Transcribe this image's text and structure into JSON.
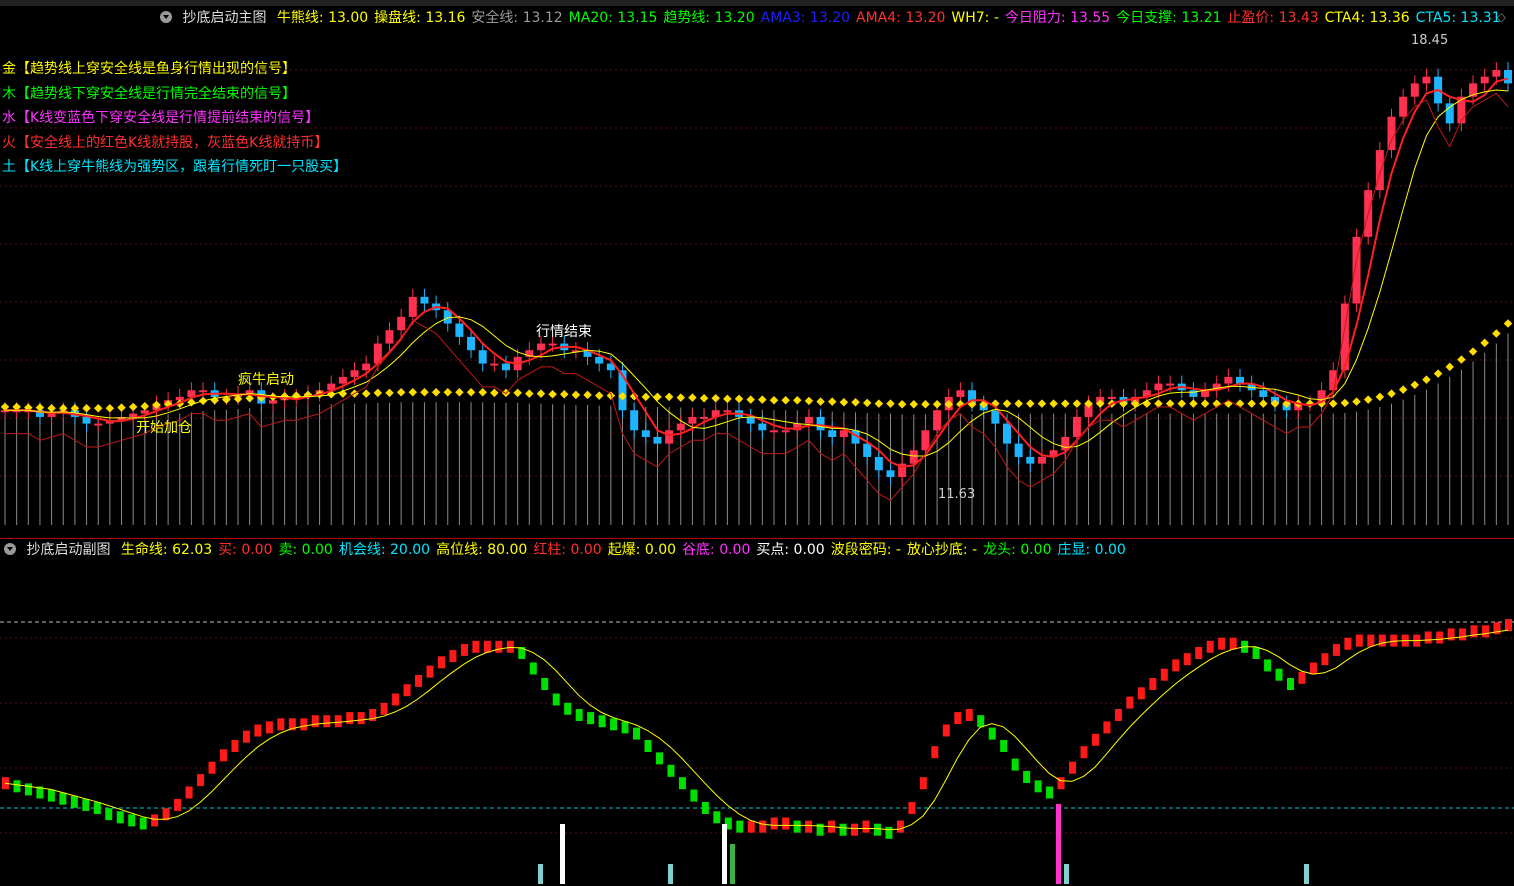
{
  "main": {
    "title": "抄底启动主图",
    "indicators": [
      {
        "label": "牛熊线:",
        "value": "13.00",
        "color": "#ffff00"
      },
      {
        "label": "操盘线:",
        "value": "13.16",
        "color": "#ffff00"
      },
      {
        "label": "安全线:",
        "value": "13.12",
        "color": "#9a9a9a"
      },
      {
        "label": "MA20:",
        "value": "13.15",
        "color": "#00ff00"
      },
      {
        "label": "趋势线:",
        "value": "13.20",
        "color": "#00ff00"
      },
      {
        "label": "AMA3:",
        "value": "13.20",
        "color": "#2020ff"
      },
      {
        "label": "AMA4:",
        "value": "13.20",
        "color": "#ff3030"
      },
      {
        "label": "WH7:",
        "value": "-",
        "color": "#ffff00"
      },
      {
        "label": "今日阻力:",
        "value": "13.55",
        "color": "#ff33ff"
      },
      {
        "label": "今日支撑:",
        "value": "13.21",
        "color": "#00ff00"
      },
      {
        "label": "止盈价:",
        "value": "13.43",
        "color": "#ff3030"
      },
      {
        "label": "CTA4:",
        "value": "13.36",
        "color": "#ffff00"
      },
      {
        "label": "CTA5:",
        "value": "13.31",
        "color": "#00e5ff"
      }
    ],
    "legend": [
      {
        "text": "金【趋势线上穿安全线是鱼身行情出现的信号】",
        "color": "#ffff00"
      },
      {
        "text": "木【趋势线下穿安全线是行情完全结束的信号】",
        "color": "#00ff00"
      },
      {
        "text": "水【K线变蓝色下穿安全线是行情提前结束的信号】",
        "color": "#ff33ff"
      },
      {
        "text": "火【安全线上的红色K线就持股，灰蓝色K线就持币】",
        "color": "#ff3030"
      },
      {
        "text": "土【K线上穿牛熊线为强势区，跟着行情死盯一只股买】",
        "color": "#00e5ff"
      }
    ],
    "annotations": [
      {
        "text": "开始加仓",
        "color": "#ffff00"
      },
      {
        "text": "疯牛启动",
        "color": "#ffff00"
      },
      {
        "text": "行情结束",
        "color": "#ffffff"
      },
      {
        "text": "18.45",
        "color": "#cccccc"
      },
      {
        "text": "11.63",
        "color": "#cccccc"
      }
    ]
  },
  "sub": {
    "title": "抄底启动副图",
    "indicators": [
      {
        "label": "生命线:",
        "value": "62.03",
        "color": "#ffff00"
      },
      {
        "label": "买:",
        "value": "0.00",
        "color": "#ff3030"
      },
      {
        "label": "卖:",
        "value": "0.00",
        "color": "#00ff00"
      },
      {
        "label": "机会线:",
        "value": "20.00",
        "color": "#00e5ff"
      },
      {
        "label": "高位线:",
        "value": "80.00",
        "color": "#ffff00"
      },
      {
        "label": "红柱:",
        "value": "0.00",
        "color": "#ff3030"
      },
      {
        "label": "起爆:",
        "value": "0.00",
        "color": "#ffff00"
      },
      {
        "label": "谷底:",
        "value": "0.00",
        "color": "#ff33ff"
      },
      {
        "label": "买点:",
        "value": "0.00",
        "color": "#ffffff"
      },
      {
        "label": "波段密码:",
        "value": "-",
        "color": "#ffff00"
      },
      {
        "label": "放心抄底:",
        "value": "-",
        "color": "#ffff00"
      },
      {
        "label": "龙头:",
        "value": "0.00",
        "color": "#00ff00"
      },
      {
        "label": "庄显:",
        "value": "0.00",
        "color": "#00e5ff"
      }
    ]
  },
  "chart_data": {
    "type": "line",
    "title": "抄底启动主图",
    "price_range": [
      11.63,
      18.45
    ],
    "high_label": "18.45",
    "low_label": "11.63",
    "candles_close": [
      12.9,
      12.9,
      12.9,
      12.8,
      12.85,
      12.9,
      12.8,
      12.7,
      12.7,
      12.75,
      12.8,
      12.85,
      12.9,
      13.0,
      13.05,
      13.1,
      13.2,
      13.2,
      13.1,
      13.1,
      13.15,
      13.2,
      13.0,
      13.05,
      13.1,
      13.1,
      13.15,
      13.2,
      13.3,
      13.4,
      13.5,
      13.6,
      13.9,
      14.1,
      14.3,
      14.6,
      14.5,
      14.4,
      14.2,
      14.0,
      13.8,
      13.6,
      13.6,
      13.5,
      13.7,
      13.8,
      13.9,
      13.9,
      13.8,
      13.8,
      13.7,
      13.6,
      13.5,
      12.9,
      12.6,
      12.5,
      12.4,
      12.6,
      12.7,
      12.8,
      12.8,
      12.9,
      12.9,
      12.8,
      12.7,
      12.6,
      12.6,
      12.6,
      12.7,
      12.8,
      12.6,
      12.5,
      12.6,
      12.4,
      12.2,
      12.0,
      11.9,
      12.1,
      12.3,
      12.6,
      12.9,
      13.1,
      13.2,
      13.0,
      12.9,
      12.7,
      12.4,
      12.2,
      12.1,
      12.2,
      12.3,
      12.5,
      12.8,
      13.0,
      13.1,
      13.1,
      13.0,
      13.1,
      13.2,
      13.3,
      13.3,
      13.2,
      13.1,
      13.2,
      13.3,
      13.4,
      13.3,
      13.2,
      13.1,
      13.0,
      12.9,
      13.0,
      13.0,
      13.2,
      13.5,
      14.5,
      15.5,
      16.2,
      16.8,
      17.3,
      17.6,
      17.8,
      17.9,
      17.5,
      17.2,
      17.6,
      17.8,
      17.9,
      18.0,
      17.8
    ],
    "bull_bear_line": [
      12.95,
      12.95,
      12.94,
      12.94,
      12.93,
      12.93,
      12.93,
      12.93,
      12.93,
      12.93,
      12.94,
      12.95,
      12.96,
      12.98,
      12.99,
      13.0,
      13.02,
      13.04,
      13.05,
      13.06,
      13.07,
      13.08,
      13.09,
      13.1,
      13.11,
      13.12,
      13.13,
      13.14,
      13.14,
      13.15,
      13.15,
      13.15,
      13.16,
      13.16,
      13.17,
      13.17,
      13.17,
      13.17,
      13.17,
      13.17,
      13.17,
      13.17,
      13.16,
      13.16,
      13.16,
      13.15,
      13.15,
      13.14,
      13.14,
      13.13,
      13.13,
      13.12,
      13.12,
      13.11,
      13.11,
      13.1,
      13.1,
      13.1,
      13.09,
      13.09,
      13.08,
      13.08,
      13.07,
      13.07,
      13.06,
      13.06,
      13.05,
      13.05,
      13.05,
      13.04,
      13.03,
      13.03,
      13.02,
      13.02,
      13.01,
      13.0,
      13.0,
      12.99,
      12.99,
      12.99,
      12.99,
      12.99,
      12.99,
      12.99,
      12.99,
      13.0,
      13.0,
      13.0,
      13.0,
      13.0,
      13.0,
      13.0,
      13.0,
      13.0,
      13.0,
      13.0,
      13.0,
      13.0,
      13.0,
      13.0,
      13.0,
      13.0,
      13.0,
      13.0,
      13.0,
      13.0,
      13.0,
      13.0,
      13.0,
      13.0,
      13.0,
      13.0,
      13.0,
      13.0,
      13.0,
      13.01,
      13.03,
      13.06,
      13.1,
      13.15,
      13.21,
      13.28,
      13.36,
      13.45,
      13.55,
      13.66,
      13.78,
      13.91,
      14.05,
      14.2
    ],
    "subchart": {
      "range": [
        0,
        100
      ],
      "lifeline_values": [
        28,
        27,
        26,
        25,
        24,
        23,
        22,
        21,
        20,
        18,
        17,
        16,
        15,
        16,
        18,
        21,
        25,
        29,
        33,
        37,
        40,
        43,
        45,
        46,
        47,
        47,
        47,
        48,
        48,
        48,
        49,
        49,
        50,
        52,
        55,
        58,
        61,
        64,
        67,
        69,
        71,
        72,
        72,
        72,
        72,
        70,
        65,
        60,
        55,
        52,
        50,
        49,
        48,
        47,
        46,
        44,
        40,
        36,
        32,
        28,
        24,
        20,
        17,
        15,
        14,
        14,
        14,
        15,
        15,
        14,
        14,
        13,
        14,
        13,
        13,
        14,
        13,
        12,
        14,
        20,
        28,
        38,
        45,
        49,
        50,
        48,
        44,
        40,
        34,
        30,
        27,
        25,
        28,
        33,
        38,
        42,
        46,
        50,
        54,
        57,
        60,
        63,
        66,
        68,
        70,
        72,
        73,
        73,
        72,
        70,
        66,
        63,
        60,
        62,
        65,
        68,
        71,
        73,
        74,
        74,
        74,
        74,
        74,
        74,
        75,
        75,
        76,
        76,
        77,
        77,
        78,
        79
      ],
      "dotted_high": 80.0,
      "dotted_low": 20.0
    }
  }
}
